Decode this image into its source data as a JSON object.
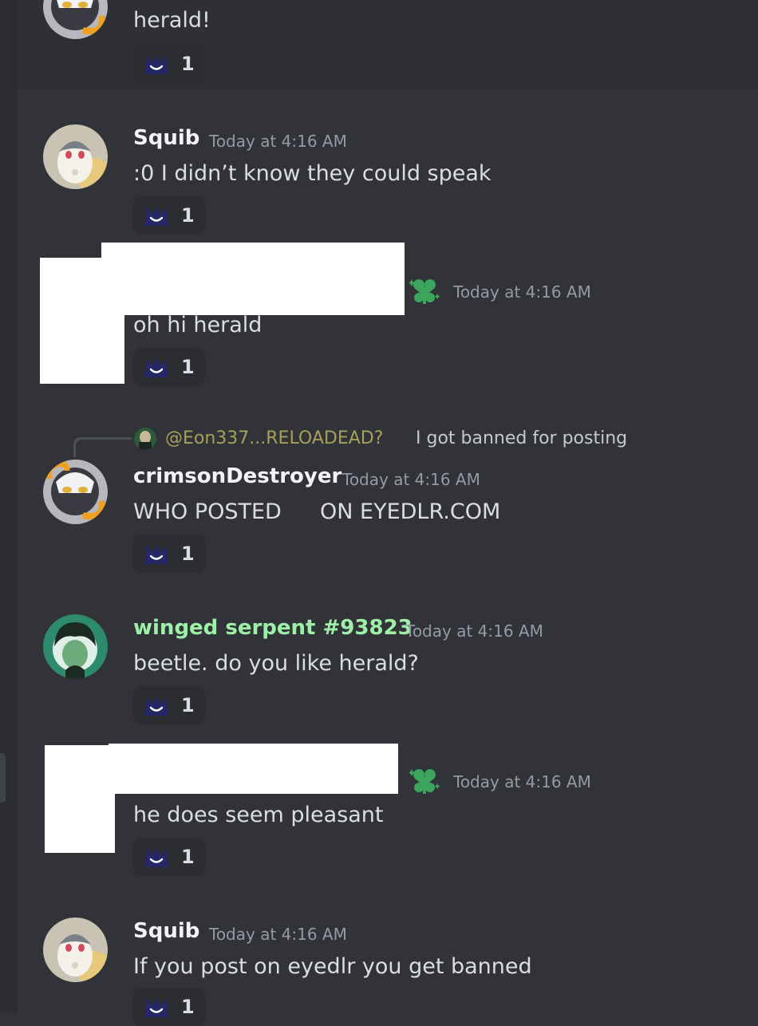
{
  "messages": [
    {
      "id": "m0",
      "author": "",
      "time": "",
      "text": "herald!",
      "reaction_count": "1"
    },
    {
      "id": "m1",
      "author": "Squib",
      "time": "Today at 4:16 AM",
      "text": ":0 I didn’t know they could speak",
      "reaction_count": "1"
    },
    {
      "id": "m2",
      "author": "",
      "time": "Today at 4:16 AM",
      "text": "oh hi herald",
      "reaction_count": "1"
    },
    {
      "id": "m3",
      "reply": {
        "mention": "@Eon337...RELOADEAD?",
        "text": "I got banned for posting"
      },
      "author": "crimsonDestroyer",
      "time": "Today at 4:16 AM",
      "text_a": "WHO POSTED",
      "text_b": "ON EYEDLR.COM",
      "reaction_count": "1"
    },
    {
      "id": "m4",
      "author": "winged serpent #93823",
      "time": "Today at 4:16 AM",
      "text": "beetle. do you like herald?",
      "reaction_count": "1"
    },
    {
      "id": "m5",
      "author": "",
      "time": "Today at 4:16 AM",
      "text": "he does seem pleasant",
      "reaction_count": "1"
    },
    {
      "id": "m6",
      "author": "Squib",
      "time": "Today at 4:16 AM",
      "text": "If you post on eyedlr you get banned",
      "reaction_count": "1"
    }
  ],
  "colors": {
    "background": "#313338",
    "author_default": "#f2f3f5",
    "author_winged_serpent": "#9ef0a8",
    "timestamp": "#949ba4",
    "reply_mention": "#a5a05a",
    "badge_green": "#3ba55c"
  },
  "icons": {
    "reaction": "smiling-hat-emoji",
    "badge": "green-clover-badge"
  }
}
